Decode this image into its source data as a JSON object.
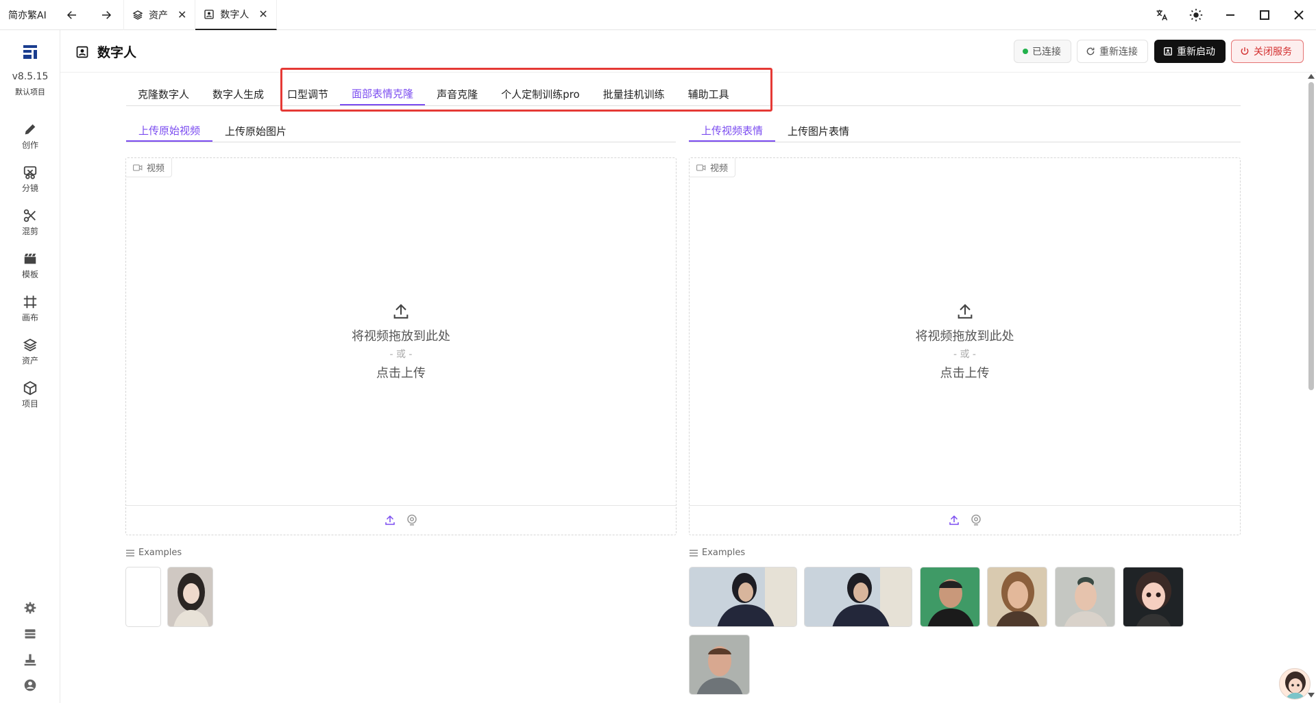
{
  "titlebar": {
    "app_name": "简亦繁AI",
    "tabs": [
      {
        "label": "资产",
        "icon": "layers-icon"
      },
      {
        "label": "数字人",
        "icon": "portrait-icon",
        "active": true
      }
    ]
  },
  "sidebar": {
    "version": "v8.5.15",
    "project": "默认项目",
    "items": [
      {
        "label": "创作",
        "icon": "pencil-icon"
      },
      {
        "label": "分镜",
        "icon": "storyboard-icon"
      },
      {
        "label": "混剪",
        "icon": "scissors-icon"
      },
      {
        "label": "模板",
        "icon": "clapper-icon"
      },
      {
        "label": "画布",
        "icon": "frame-icon"
      },
      {
        "label": "资产",
        "icon": "layers-icon"
      },
      {
        "label": "项目",
        "icon": "cube-icon"
      }
    ],
    "bottom_icons": [
      "gear-icon",
      "list-icon",
      "stamp-icon",
      "account-icon"
    ]
  },
  "header": {
    "title": "数字人",
    "connected_label": "已连接",
    "reconnect_label": "重新连接",
    "restart_label": "重新启动",
    "close_service_label": "关闭服务"
  },
  "main_tabs": [
    "克隆数字人",
    "数字人生成",
    "口型调节",
    "面部表情克隆",
    "声音克隆",
    "个人定制训练pro",
    "批量挂机训练",
    "辅助工具"
  ],
  "main_tab_active": "面部表情克隆",
  "left_panel": {
    "tabs": [
      "上传原始视频",
      "上传原始图片"
    ],
    "tag": "视频",
    "drop_text": "将视频拖放到此处",
    "or_text": "- 或 -",
    "click_text": "点击上传",
    "examples_label": "Examples"
  },
  "right_panel": {
    "tabs": [
      "上传视频表情",
      "上传图片表情"
    ],
    "tag": "视频",
    "drop_text": "将视频拖放到此处",
    "or_text": "- 或 -",
    "click_text": "点击上传",
    "examples_label": "Examples"
  },
  "colors": {
    "accent": "#7b4cf0",
    "danger": "#d32f2f",
    "connected": "#22b14c",
    "highlight": "#e53935"
  }
}
